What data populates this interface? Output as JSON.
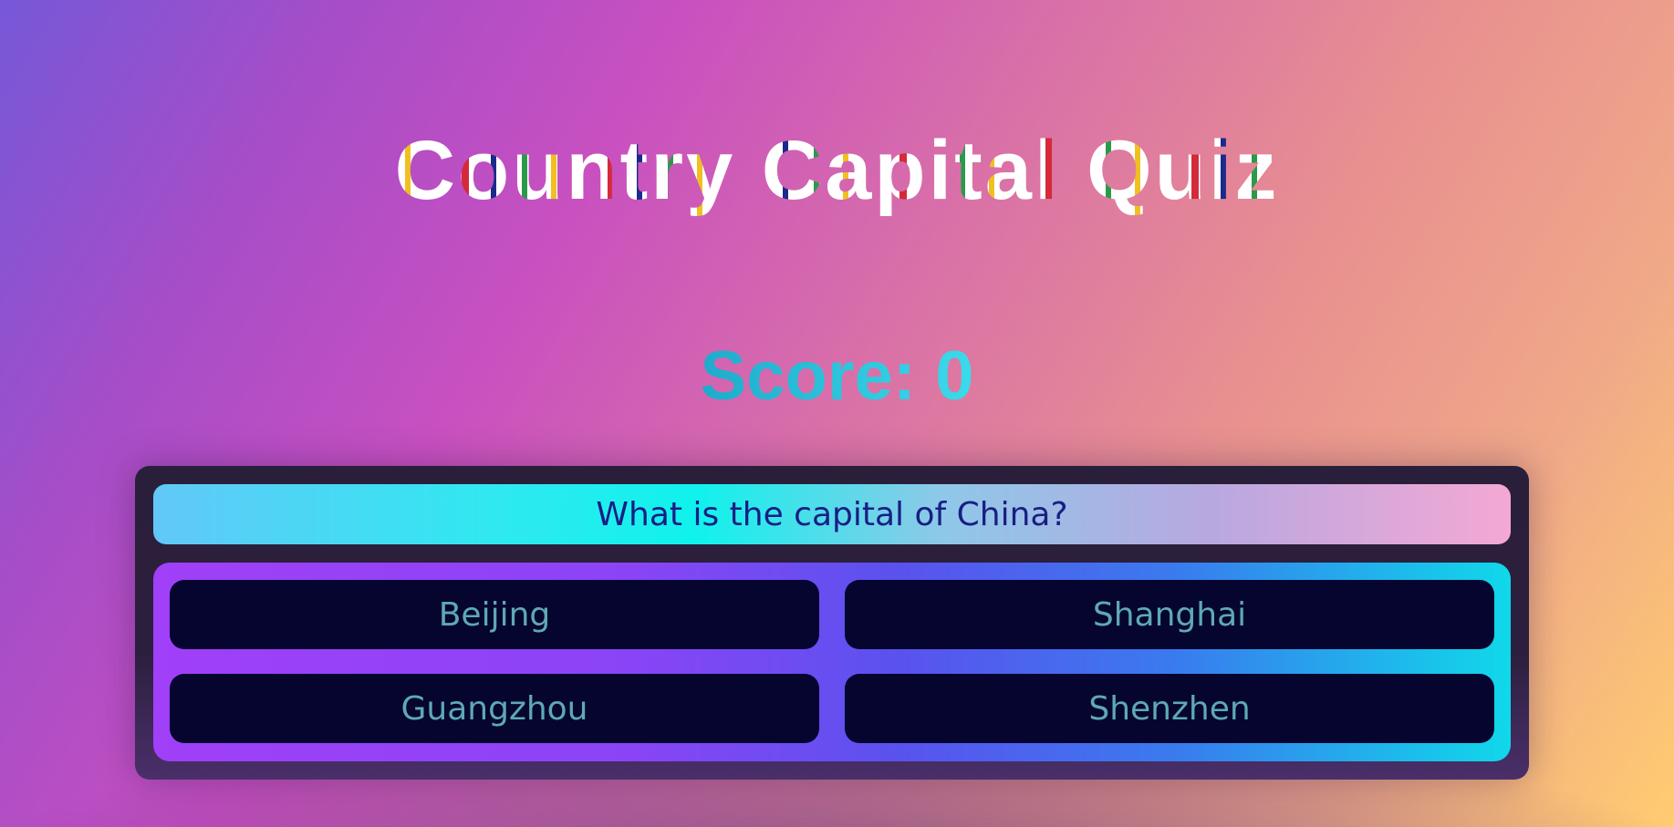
{
  "title": "Country Capital Quiz",
  "score": {
    "label": "Score:",
    "value": "0"
  },
  "question": "What is the capital of China?",
  "answers": [
    {
      "label": "Beijing"
    },
    {
      "label": "Shanghai"
    },
    {
      "label": "Guangzhou"
    },
    {
      "label": "Shenzhen"
    }
  ],
  "colors": {
    "question_text": "#191e84",
    "answer_text": "#5fa8b4",
    "answer_bg": "#050530",
    "score_text": "#2ac4dc"
  }
}
